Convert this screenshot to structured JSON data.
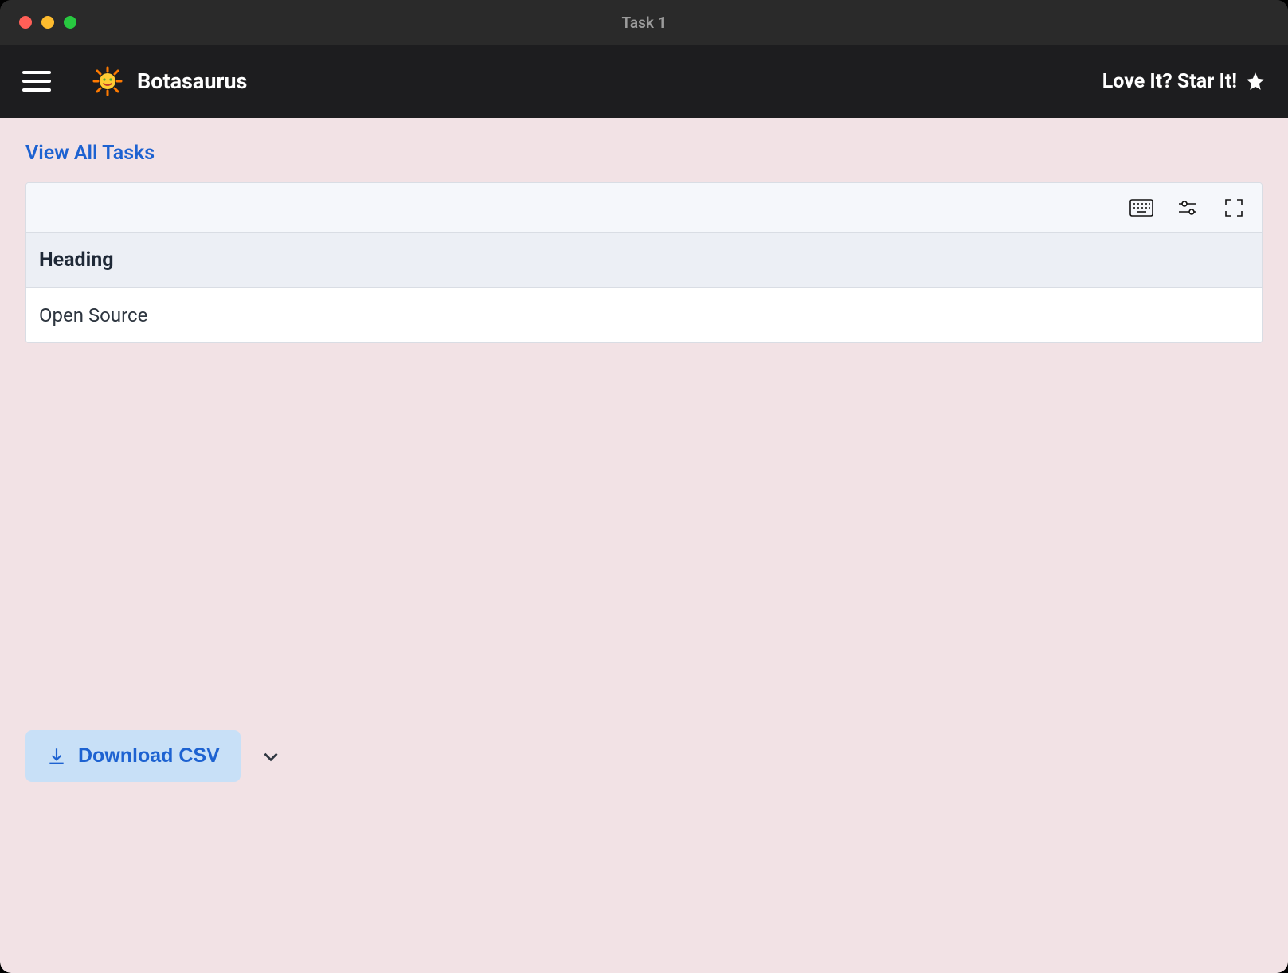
{
  "window": {
    "title": "Task 1"
  },
  "appbar": {
    "brand_name": "Botasaurus",
    "star_cta": "Love It? Star It!"
  },
  "main": {
    "view_all_label": "View All Tasks",
    "table": {
      "columns": [
        "Heading"
      ],
      "rows": [
        {
          "heading": "Open Source"
        }
      ]
    },
    "download_label": "Download CSV"
  }
}
